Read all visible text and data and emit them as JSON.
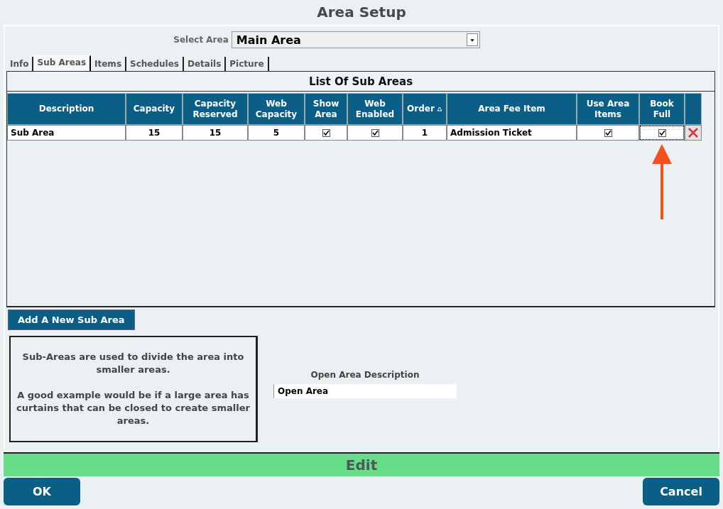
{
  "title": "Area Setup",
  "select_area": {
    "label": "Select Area",
    "value": "Main Area"
  },
  "tabs": [
    {
      "label": "Info",
      "selected": false
    },
    {
      "label": "Sub Areas",
      "selected": true
    },
    {
      "label": "Items",
      "selected": false
    },
    {
      "label": "Schedules",
      "selected": false
    },
    {
      "label": "Details",
      "selected": false
    },
    {
      "label": "Picture",
      "selected": false
    }
  ],
  "list_title": "List Of Sub Areas",
  "table": {
    "columns": [
      {
        "label": "Description",
        "sorted": false
      },
      {
        "label": "Capacity",
        "sorted": false
      },
      {
        "label": "Capacity Reserved",
        "sorted": false
      },
      {
        "label": "Web Capacity",
        "sorted": false
      },
      {
        "label": "Show Area",
        "sorted": false
      },
      {
        "label": "Web Enabled",
        "sorted": false
      },
      {
        "label": "Order",
        "sorted": true
      },
      {
        "label": "Area Fee Item",
        "sorted": false
      },
      {
        "label": "Use Area Items",
        "sorted": false
      },
      {
        "label": "Book Full",
        "sorted": false
      }
    ],
    "rows": [
      {
        "cells": [
          {
            "kind": "text",
            "text": "Sub Area"
          },
          {
            "kind": "text",
            "text": "15"
          },
          {
            "kind": "text",
            "text": "15"
          },
          {
            "kind": "text",
            "text": "5"
          },
          {
            "kind": "check",
            "checked": true
          },
          {
            "kind": "check",
            "checked": true
          },
          {
            "kind": "text",
            "text": "1"
          },
          {
            "kind": "text",
            "text": "Admission Ticket"
          },
          {
            "kind": "check",
            "checked": true
          },
          {
            "kind": "check",
            "checked": true,
            "focused": true
          }
        ]
      }
    ]
  },
  "add_button": "Add A New Sub Area",
  "help_text": [
    "Sub-Areas are used to divide the area into smaller areas.",
    "A good example would be if a large area has curtains that can be closed to create smaller areas."
  ],
  "open_area": {
    "label": "Open Area Description",
    "value": "Open Area"
  },
  "mode": "Edit",
  "buttons": {
    "ok": "OK",
    "cancel": "Cancel"
  }
}
